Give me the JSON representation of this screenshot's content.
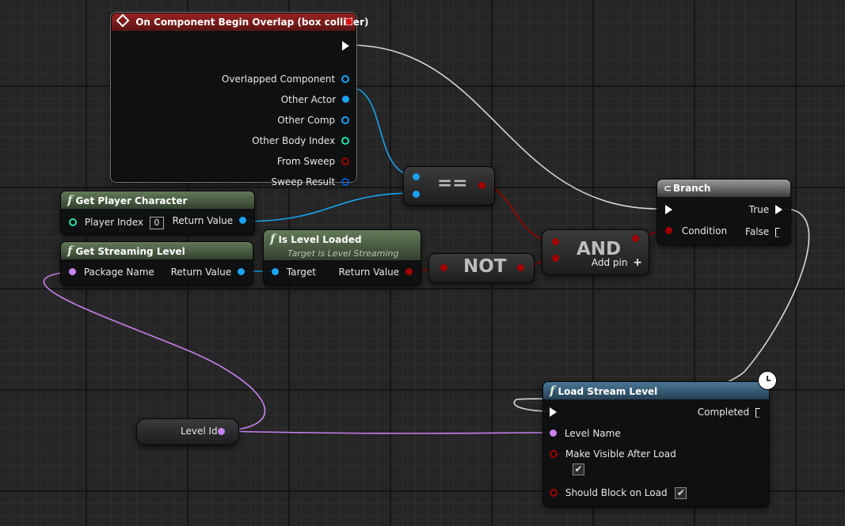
{
  "event_node": {
    "title": "On Component Begin Overlap (box collider)",
    "pins": [
      "Overlapped Component",
      "Other Actor",
      "Other Comp",
      "Other Body Index",
      "From Sweep",
      "Sweep Result"
    ]
  },
  "get_player_character": {
    "title": "Get Player Character",
    "player_index_label": "Player Index",
    "player_index_value": "0",
    "return_label": "Return Value"
  },
  "get_streaming_level": {
    "title": "Get Streaming Level",
    "package_label": "Package Name",
    "return_label": "Return Value"
  },
  "is_level_loaded": {
    "title": "Is Level Loaded",
    "subtitle": "Target is Level Streaming",
    "target_label": "Target",
    "return_label": "Return Value"
  },
  "equal_op": {
    "label": "=="
  },
  "not_op": {
    "label": "NOT"
  },
  "and_op": {
    "label": "AND",
    "add_pin_label": "Add pin",
    "add_icon": "+"
  },
  "branch": {
    "title": "Branch",
    "true_label": "True",
    "condition_label": "Condition",
    "false_label": "False"
  },
  "level_id": {
    "label": "Level Id"
  },
  "load_stream_level": {
    "title": "Load Stream Level",
    "completed_label": "Completed",
    "level_name_label": "Level Name",
    "make_visible_label": "Make Visible After Load",
    "should_block_label": "Should Block on Load",
    "check_mark": "✔"
  },
  "colors": {
    "event_header": "#9a2222",
    "function_header": "#5a7050",
    "latent_header": "#4a7896",
    "object_pin": "#1aa3f0",
    "name_pin": "#c882f0",
    "bool_pin": "#a10000",
    "int_pin": "#1fe3af",
    "struct_pin": "#0058c8",
    "exec_wire": "#d8d8d8"
  }
}
